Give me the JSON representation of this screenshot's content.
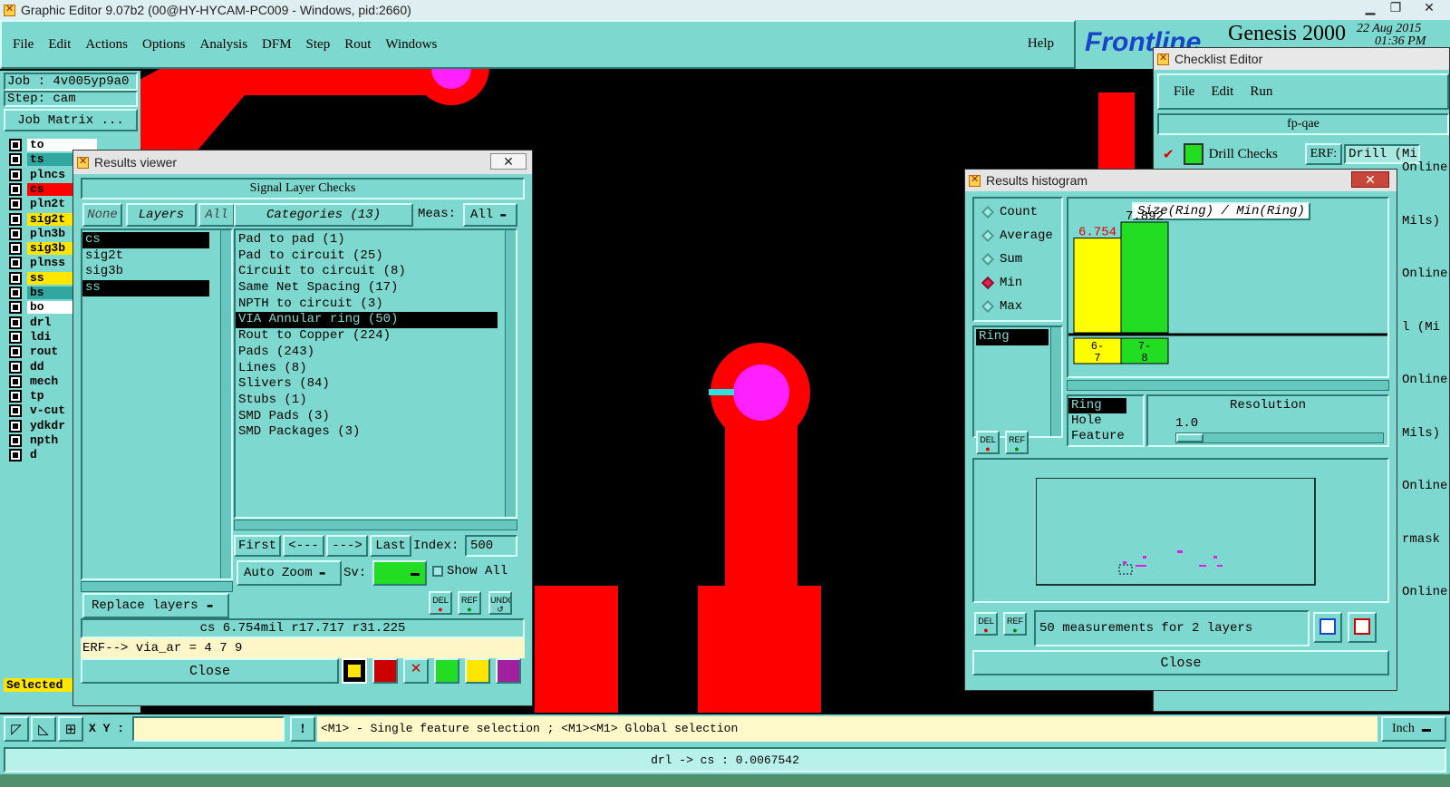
{
  "app": {
    "title": "Graphic Editor 9.07b2 (00@HY-HYCAM-PC009 - Windows, pid:2660)",
    "menu": [
      "File",
      "Edit",
      "Actions",
      "Options",
      "Analysis",
      "DFM",
      "Step",
      "Rout",
      "Windows"
    ],
    "help": "Help",
    "brand": "Frontline",
    "product": "Genesis 2000",
    "date": "22 Aug 2015",
    "time": "01:36 PM"
  },
  "job": {
    "job": "Job : 4v005yp9a0",
    "step": "Step: cam",
    "matrix_button": "Job Matrix ..."
  },
  "layers": [
    {
      "name": "to",
      "color": "#ffffff"
    },
    {
      "name": "ts",
      "color": "#30a8a0"
    },
    {
      "name": "plncs",
      "color": "#7dd8cf"
    },
    {
      "name": "cs",
      "color": "#ff0000"
    },
    {
      "name": "pln2t",
      "color": "#7dd8cf"
    },
    {
      "name": "sig2t",
      "color": "#ffe600"
    },
    {
      "name": "pln3b",
      "color": "#7dd8cf"
    },
    {
      "name": "sig3b",
      "color": "#ffe600"
    },
    {
      "name": "plnss",
      "color": "#7dd8cf"
    },
    {
      "name": "ss",
      "color": "#ffe600"
    },
    {
      "name": "bs",
      "color": "#30a8a0"
    },
    {
      "name": "bo",
      "color": "#ffffff"
    },
    {
      "name": "drl",
      "color": "#7dd8cf"
    },
    {
      "name": "ldi",
      "color": "#7dd8cf"
    },
    {
      "name": "rout",
      "color": "#7dd8cf"
    },
    {
      "name": "dd",
      "color": "#7dd8cf"
    },
    {
      "name": "mech",
      "color": "#7dd8cf"
    },
    {
      "name": "tp",
      "color": "#7dd8cf"
    },
    {
      "name": "v-cut",
      "color": "#7dd8cf"
    },
    {
      "name": "ydkdr",
      "color": "#7dd8cf"
    },
    {
      "name": "npth",
      "color": "#7dd8cf"
    },
    {
      "name": "d",
      "color": "#7dd8cf"
    }
  ],
  "selected_label": "Selected :",
  "results_viewer": {
    "title": "Results viewer",
    "header": "Signal Layer Checks",
    "none": "None",
    "layers_btn": "Layers",
    "all": "All",
    "layer_list": [
      "cs",
      "sig2t",
      "sig3b",
      "ss"
    ],
    "categories_btn": "Categories (13)",
    "meas_label": "Meas:",
    "meas_value": "All",
    "categories": [
      "Pad to pad (1)",
      "Pad to circuit (25)",
      "Circuit to circuit (8)",
      "Same Net Spacing (17)",
      "NPTH to circuit (3)",
      "VIA Annular ring (50)",
      "Rout to Copper (224)",
      "Pads (243)",
      "Lines (8)",
      "Slivers (84)",
      "Stubs (1)",
      "SMD Pads (3)",
      "SMD Packages (3)"
    ],
    "first": "First",
    "prev": "<---",
    "next": "--->",
    "last": "Last",
    "index_label": "Index:",
    "index_value": "500",
    "auto_zoom": "Auto Zoom",
    "sv_label": "Sv:",
    "show_all": "Show All",
    "replace_layers": "Replace layers",
    "measure": "cs 6.754mil  r17.717  r31.225",
    "erf": "ERF--> via_ar = 4 7 9",
    "close": "Close",
    "del": "DEL",
    "ref": "REF",
    "undo": "UNDO"
  },
  "histogram": {
    "title": "Results histogram",
    "modes": [
      "Count",
      "Average",
      "Sum",
      "Min",
      "Max"
    ],
    "mode_selected": "Min",
    "chart_title": "Size(Ring) / Min(Ring)",
    "ring_list": [
      "Ring"
    ],
    "attrs": [
      "Ring",
      "Hole",
      "Feature"
    ],
    "resolution_label": "Resolution",
    "resolution_value": "1.0",
    "measurements": "50 measurements for 2 layers",
    "close": "Close"
  },
  "chart_data": {
    "type": "bar",
    "title": "Size(Ring) / Min(Ring)",
    "categories": [
      "6-7",
      "7-8"
    ],
    "values": [
      6.754,
      7.892
    ],
    "colors": [
      "#ffff00",
      "#22dd22"
    ],
    "ylim": [
      0,
      7.892
    ]
  },
  "checklist": {
    "title": "Checklist Editor",
    "menu": [
      "File",
      "Edit",
      "Run"
    ],
    "name": "fp-qae",
    "check": "Drill Checks",
    "erf_label": "ERF:",
    "erf_value": "Drill (Mil",
    "right_items": [
      "Online...",
      "Mils)",
      "Online...",
      "l (Mi",
      "Online...",
      "Mils)",
      "Online...",
      "rmask",
      "Online..."
    ]
  },
  "statusbar": {
    "xy_label": "X Y :",
    "hint": "<M1> - Single feature selection ; <M1><M1> Global selection",
    "units": "Inch",
    "bottom": "drl -> cs : 0.0067542"
  }
}
